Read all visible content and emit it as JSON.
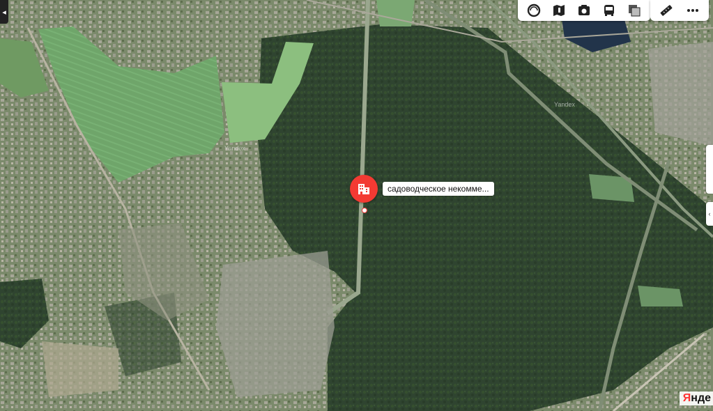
{
  "map": {
    "type": "satellite",
    "watermark": "Yandex"
  },
  "toolbar": {
    "buttons": [
      {
        "name": "layers-button",
        "icon": "circle-layers-icon"
      },
      {
        "name": "panorama-button",
        "icon": "map-book-icon"
      },
      {
        "name": "photos-button",
        "icon": "camera-icon"
      },
      {
        "name": "transport-button",
        "icon": "bus-icon"
      },
      {
        "name": "map-type-button",
        "icon": "map-layers-icon"
      }
    ],
    "tools": [
      {
        "name": "ruler-button",
        "icon": "ruler-icon"
      },
      {
        "name": "more-button",
        "icon": "ellipsis-icon"
      }
    ]
  },
  "placemark": {
    "label": "садоводческое некомме...",
    "icon": "building-icon",
    "color": "#f33a33"
  },
  "copyright": {
    "logo_first": "Я",
    "logo_rest": "нде"
  },
  "left_tab_glyph": "◂",
  "right_tab_glyph": "‹"
}
